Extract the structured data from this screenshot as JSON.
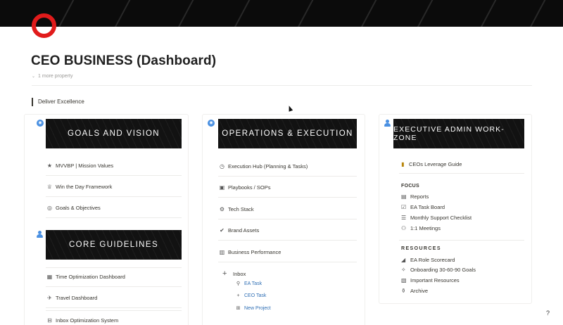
{
  "page": {
    "title": "CEO BUSINESS (Dashboard)",
    "more_property": "1 more property",
    "callout": "Deliver Excellence",
    "help_icon": "?"
  },
  "colors": {
    "logo_ring": "#e11b1b",
    "cover": "#0b0b0b",
    "banner": "#121212",
    "link": "#2f6fb5",
    "user_icon": "#4a90e2"
  },
  "col1": {
    "banner1": "GOALS AND VISION",
    "items1": [
      {
        "icon": "star-icon",
        "glyph": "★",
        "label": "MVVBP | Mission Values"
      },
      {
        "icon": "trophy-icon",
        "glyph": "🏆",
        "label": "Win the Day Framework"
      },
      {
        "icon": "target-icon",
        "glyph": "◎",
        "label": "Goals & Objectives"
      }
    ],
    "banner2": "CORE GUIDELINES",
    "items2": [
      {
        "icon": "calendar-icon",
        "glyph": "▦",
        "label": "Time Optimization Dashboard"
      },
      {
        "icon": "plane-icon",
        "glyph": "✈",
        "label": "Travel Dashboard"
      },
      {
        "icon": "inbox-icon",
        "glyph": "⊟",
        "label": "Inbox Optimization System"
      }
    ]
  },
  "col2": {
    "banner": "OPERATIONS & EXECUTION",
    "items": [
      {
        "icon": "hub-icon",
        "glyph": "◷",
        "label": "Execution Hub (Planning & Tasks)"
      },
      {
        "icon": "book-icon",
        "glyph": "▣",
        "label": "Playbooks / SOPs"
      },
      {
        "icon": "robot-icon",
        "glyph": "⚙",
        "label": "Tech Stack"
      },
      {
        "icon": "verified-icon",
        "glyph": "✔",
        "label": "Brand Assets"
      },
      {
        "icon": "chart-icon",
        "glyph": "▥",
        "label": "Business Performance"
      }
    ],
    "inbox_label": "Inbox",
    "sub_items": [
      {
        "icon": "add-person-icon",
        "glyph": "👤",
        "label": "EA Task"
      },
      {
        "icon": "plus-icon",
        "glyph": "+",
        "label": "CEO Task"
      },
      {
        "icon": "new-project-icon",
        "glyph": "⊞",
        "label": "New Project"
      }
    ]
  },
  "col3": {
    "banner": "EXECUTIVE ADMIN WORK-ZONE",
    "guide": {
      "icon": "document-icon",
      "glyph": "📜",
      "label": "CEOs Leverage Guide"
    },
    "focus_heading": "FOCUS",
    "focus_items": [
      {
        "icon": "report-icon",
        "glyph": "▤",
        "label": "Reports"
      },
      {
        "icon": "checkbox-icon",
        "glyph": "☑",
        "label": "EA Task Board"
      },
      {
        "icon": "checklist-icon",
        "glyph": "☰",
        "label": "Monthly Support Checklist"
      },
      {
        "icon": "meeting-icon",
        "glyph": "⚇",
        "label": "1:1 Meetings"
      }
    ],
    "resources_heading": "RESOURCES",
    "resource_items": [
      {
        "icon": "line-chart-icon",
        "glyph": "◢",
        "label": "EA Role Scorecard"
      },
      {
        "icon": "rocket-icon",
        "glyph": "✧",
        "label": "Onboarding 30-60-90 Goals"
      },
      {
        "icon": "folder-icon",
        "glyph": "▧",
        "label": "Important Resources"
      },
      {
        "icon": "archive-icon",
        "glyph": "⚱",
        "label": "Archive"
      }
    ]
  }
}
